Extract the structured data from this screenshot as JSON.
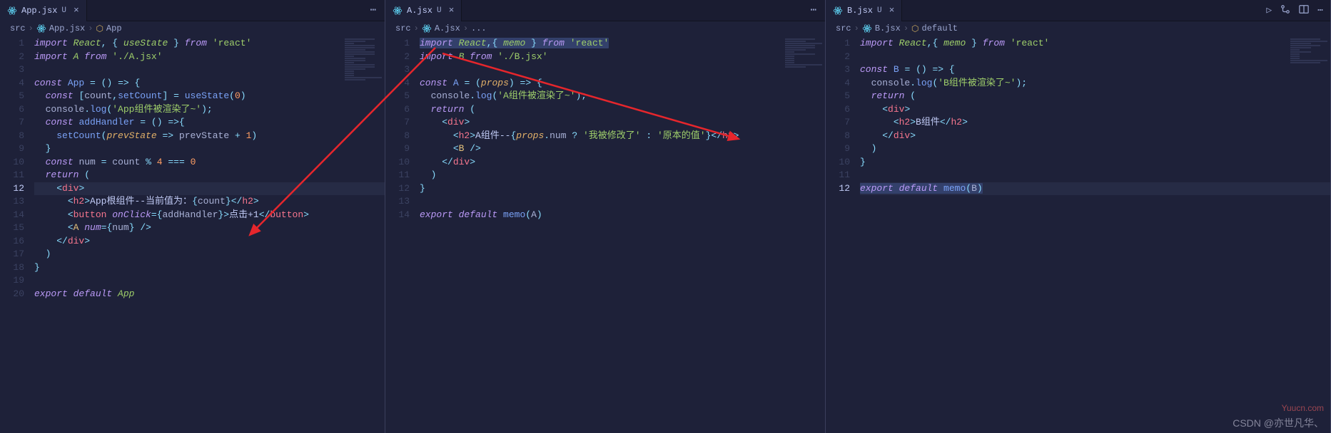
{
  "panes": [
    {
      "tab": {
        "icon": "react-icon",
        "filename": "App.jsx",
        "status": "U",
        "close": "×"
      },
      "menu_dots": "⋯",
      "breadcrumb": {
        "items": [
          "src",
          "App.jsx",
          "App"
        ],
        "has_symbol": true
      },
      "lines": 20,
      "active_line": 12,
      "code": [
        {
          "html": "<span class='kw'>import</span> <span class='type'>React</span><span class='punc'>,</span> <span class='punc'>{</span> <span class='type'>useState</span> <span class='punc'>}</span> <span class='kw'>from</span> <span class='str'>'react'</span>"
        },
        {
          "html": "<span class='kw'>import</span> <span class='type'>A</span> <span class='kw'>from</span> <span class='str'>'./A.jsx'</span>"
        },
        {
          "html": ""
        },
        {
          "html": "<span class='kw'>const</span> <span class='fn'>App</span> <span class='op'>=</span> <span class='punc'>()</span> <span class='op'>=&gt;</span> <span class='punc'>{</span>"
        },
        {
          "html": "  <span class='kw'>const</span> <span class='punc'>[</span><span class='plain'>count</span><span class='punc'>,</span><span class='fn'>setCount</span><span class='punc'>]</span> <span class='op'>=</span> <span class='fn'>useState</span><span class='punc'>(</span><span class='num'>0</span><span class='punc'>)</span>"
        },
        {
          "html": "  <span class='plain'>console</span><span class='punc'>.</span><span class='fn'>log</span><span class='punc'>(</span><span class='str'>'App组件被渲染了~'</span><span class='punc'>);</span>"
        },
        {
          "html": "  <span class='kw'>const</span> <span class='fn'>addHandler</span> <span class='op'>=</span> <span class='punc'>()</span> <span class='op'>=&gt;</span><span class='punc'>{</span>"
        },
        {
          "html": "    <span class='fn'>setCount</span><span class='punc'>(</span><span class='prm'>prevState</span> <span class='op'>=&gt;</span> <span class='plain'>prevState</span> <span class='op'>+</span> <span class='num'>1</span><span class='punc'>)</span>"
        },
        {
          "html": "  <span class='punc'>}</span>"
        },
        {
          "html": "  <span class='kw'>const</span> <span class='plain'>num</span> <span class='op'>=</span> <span class='plain'>count</span> <span class='op'>%</span> <span class='num'>4</span> <span class='op'>===</span> <span class='num'>0</span>"
        },
        {
          "html": "  <span class='kw'>return</span> <span class='punc'>(</span>"
        },
        {
          "html": "    <span class='punc'>&lt;</span><span class='tag'>div</span><span class='punc'>&gt;</span>",
          "cursor": true
        },
        {
          "html": "      <span class='punc'>&lt;</span><span class='tag'>h2</span><span class='punc'>&gt;</span><span class='txt'>App根组件--当前值为：</span><span class='punc'>{</span><span class='plain'>count</span><span class='punc'>}</span><span class='punc'>&lt;/</span><span class='tag'>h2</span><span class='punc'>&gt;</span>"
        },
        {
          "html": "      <span class='punc'>&lt;</span><span class='tag'>button</span> <span class='attr'>onClick</span><span class='op'>=</span><span class='punc'>{</span><span class='plain'>addHandler</span><span class='punc'>}&gt;</span><span class='txt'>点击+1</span><span class='punc'>&lt;/</span><span class='tag'>button</span><span class='punc'>&gt;</span>"
        },
        {
          "html": "      <span class='punc'>&lt;</span><span class='cmp'>A</span> <span class='attr'>num</span><span class='op'>=</span><span class='punc'>{</span><span class='plain'>num</span><span class='punc'>}</span> <span class='punc'>/&gt;</span>"
        },
        {
          "html": "    <span class='punc'>&lt;/</span><span class='tag'>div</span><span class='punc'>&gt;</span>"
        },
        {
          "html": "  <span class='punc'>)</span>"
        },
        {
          "html": "<span class='punc'>}</span>"
        },
        {
          "html": ""
        },
        {
          "html": "<span class='kw'>export</span> <span class='kw'>default</span> <span class='type'>App</span>"
        }
      ]
    },
    {
      "tab": {
        "icon": "react-icon",
        "filename": "A.jsx",
        "status": "U",
        "close": "×"
      },
      "menu_dots": "⋯",
      "breadcrumb": {
        "items": [
          "src",
          "A.jsx",
          "..."
        ],
        "has_symbol": false
      },
      "lines": 14,
      "active_line": null,
      "code": [
        {
          "html": "<span class='sel'><span class='kw'>import</span> <span class='type'>React</span><span class='punc'>,{</span> <span class='type'>memo</span> <span class='punc'>}</span> <span class='kw'>from</span> <span class='str'>'react'</span></span>"
        },
        {
          "html": "<span class='kw'>import</span> <span class='type'>B</span> <span class='kw'>from</span> <span class='str'>'./B.jsx'</span>"
        },
        {
          "html": ""
        },
        {
          "html": "<span class='kw'>const</span> <span class='fn'>A</span> <span class='op'>=</span> <span class='punc'>(</span><span class='prm'>props</span><span class='punc'>)</span> <span class='op'>=&gt;</span> <span class='punc'>{</span>"
        },
        {
          "html": "  <span class='plain'>console</span><span class='punc'>.</span><span class='fn'>log</span><span class='punc'>(</span><span class='str'>'A组件被渲染了~'</span><span class='punc'>);</span>"
        },
        {
          "html": "  <span class='kw'>return</span> <span class='punc'>(</span>"
        },
        {
          "html": "    <span class='punc'>&lt;</span><span class='tag'>div</span><span class='punc'>&gt;</span>"
        },
        {
          "html": "      <span class='punc'>&lt;</span><span class='tag'>h2</span><span class='punc'>&gt;</span><span class='txt'>A组件--</span><span class='punc'>{</span><span class='prm'>props</span><span class='punc'>.</span><span class='plain'>num</span> <span class='op'>?</span> <span class='str'>'我被修改了'</span> <span class='op'>:</span> <span class='str'>'原本的值'</span><span class='punc'>}</span><span class='punc'>&lt;/</span><span class='tag'>h2</span><span class='punc'>&gt;</span>"
        },
        {
          "html": "      <span class='punc'>&lt;</span><span class='cmp'>B</span> <span class='punc'>/&gt;</span>"
        },
        {
          "html": "    <span class='punc'>&lt;/</span><span class='tag'>div</span><span class='punc'>&gt;</span>"
        },
        {
          "html": "  <span class='punc'>)</span>"
        },
        {
          "html": "<span class='punc'>}</span>"
        },
        {
          "html": ""
        },
        {
          "html": "<span class='kw'>export</span> <span class='kw'>default</span> <span class='fn'>memo</span><span class='punc'>(</span><span class='plain'>A</span><span class='punc'>)</span>"
        }
      ]
    },
    {
      "tab": {
        "icon": "react-icon",
        "filename": "B.jsx",
        "status": "U",
        "close": "×"
      },
      "toolbar": {
        "run": "run-icon",
        "split": "split-icon",
        "layout": "layout-icon",
        "more": "⋯"
      },
      "breadcrumb": {
        "items": [
          "src",
          "B.jsx",
          "default"
        ],
        "has_symbol": true
      },
      "lines": 12,
      "active_line": 12,
      "code": [
        {
          "html": "<span class='kw'>import</span> <span class='type'>React</span><span class='punc'>,{</span> <span class='type'>memo</span> <span class='punc'>}</span> <span class='kw'>from</span> <span class='str'>'react'</span>"
        },
        {
          "html": ""
        },
        {
          "html": "<span class='kw'>const</span> <span class='fn'>B</span> <span class='op'>=</span> <span class='punc'>()</span> <span class='op'>=&gt;</span> <span class='punc'>{</span>"
        },
        {
          "html": "  <span class='plain'>console</span><span class='punc'>.</span><span class='fn'>log</span><span class='punc'>(</span><span class='str'>'B组件被渲染了~'</span><span class='punc'>);</span>"
        },
        {
          "html": "  <span class='kw'>return</span> <span class='punc'>(</span>"
        },
        {
          "html": "    <span class='punc'>&lt;</span><span class='tag'>div</span><span class='punc'>&gt;</span>"
        },
        {
          "html": "      <span class='punc'>&lt;</span><span class='tag'>h2</span><span class='punc'>&gt;</span><span class='txt'>B组件</span><span class='punc'>&lt;/</span><span class='tag'>h2</span><span class='punc'>&gt;</span>"
        },
        {
          "html": "    <span class='punc'>&lt;/</span><span class='tag'>div</span><span class='punc'>&gt;</span>"
        },
        {
          "html": "  <span class='punc'>)</span>"
        },
        {
          "html": "<span class='punc'>}</span>"
        },
        {
          "html": ""
        },
        {
          "html": "<span class='sel'><span class='kw'>export</span> <span class='kw'>default</span> <span class='fn'>memo</span><span class='punc'>(</span><span class='plain'>B</span><span class='punc'>)</span></span>",
          "cursor": true
        }
      ]
    }
  ],
  "watermark1": "CSDN @亦世凡华、",
  "watermark2": "Yuucn.com"
}
